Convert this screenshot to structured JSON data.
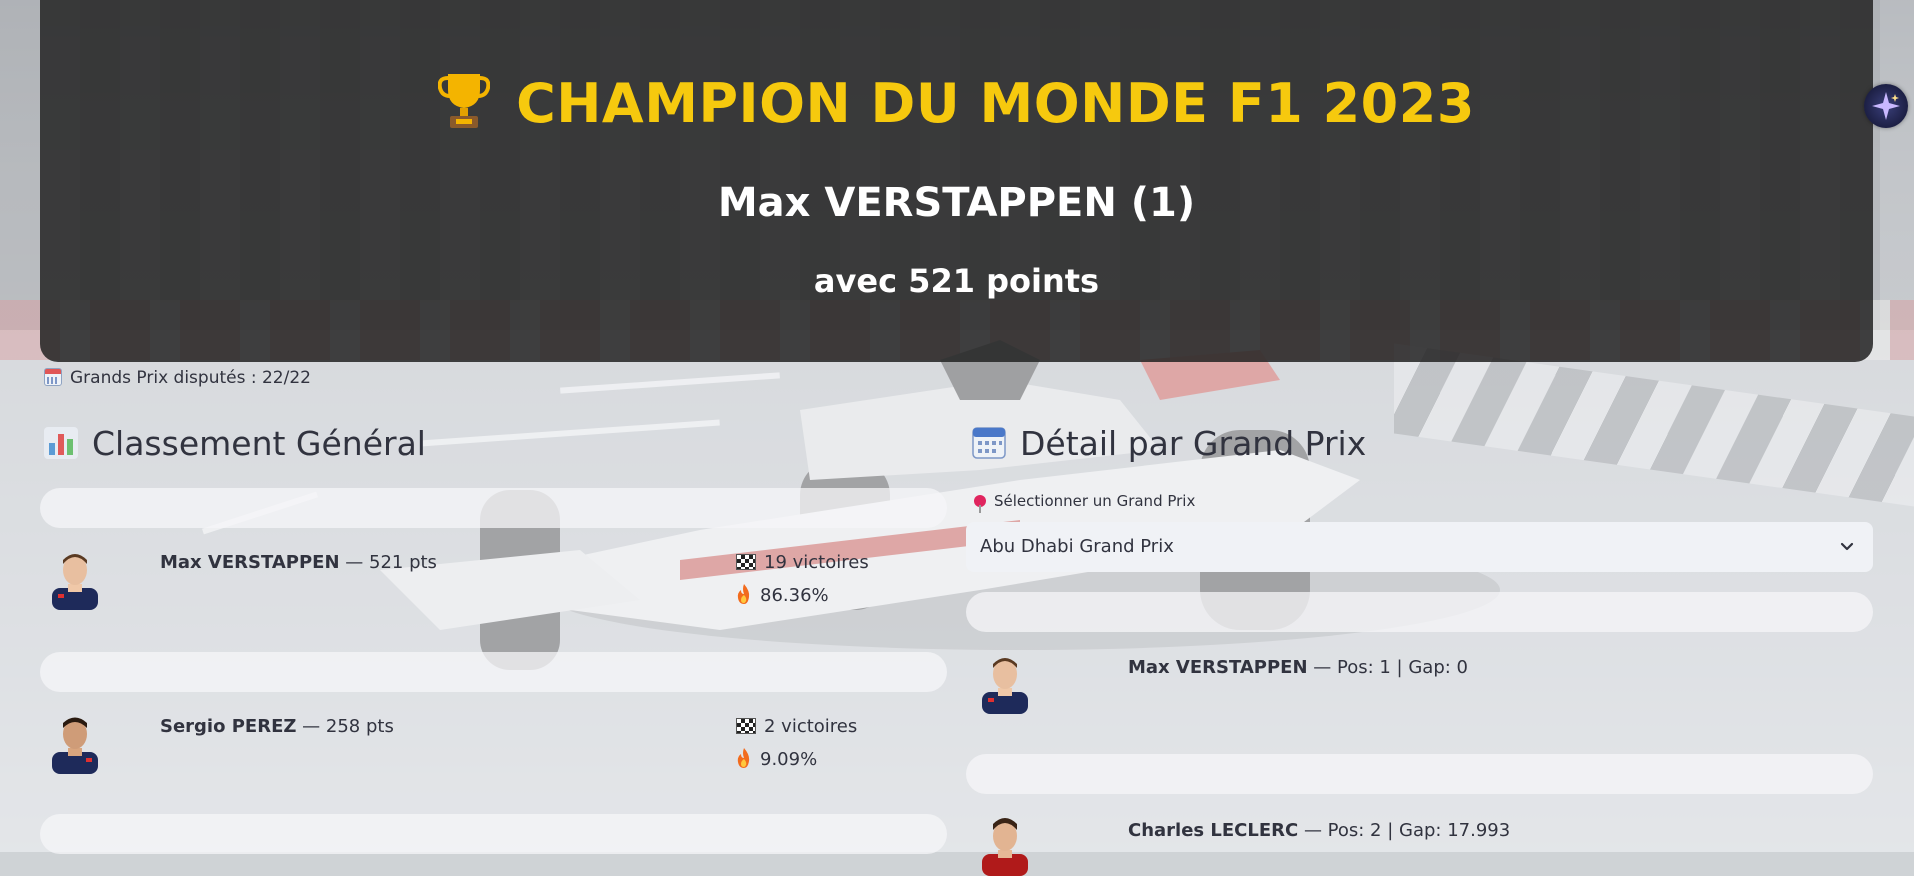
{
  "banner": {
    "title": "CHAMPION DU MONDE F1 2023",
    "champion": "Max VERSTAPPEN (1)",
    "points": "avec 521 points"
  },
  "info": {
    "races_done": "Grands Prix disputés : 22/22"
  },
  "standings": {
    "heading": "Classement Général",
    "drivers": [
      {
        "name": "Max VERSTAPPEN",
        "points": " — 521 pts",
        "wins": "19 victoires",
        "rate": "86.36%"
      },
      {
        "name": "Sergio PEREZ",
        "points": " — 258 pts",
        "wins": "2 victoires",
        "rate": "9.09%"
      }
    ]
  },
  "gp_detail": {
    "heading": "Détail par Grand Prix",
    "select_label": "Sélectionner un Grand Prix",
    "selected_gp": "Abu Dhabi Grand Prix",
    "results": [
      {
        "name": "Max VERSTAPPEN",
        "info": " — Pos: 1 | Gap: 0"
      },
      {
        "name": "Charles LECLERC",
        "info": " — Pos: 2 | Gap: 17.993"
      }
    ]
  },
  "colors": {
    "title_gold": "#f6c90e",
    "banner_bg": "#232323",
    "text": "#31333f"
  },
  "icons": [
    "trophy-icon",
    "calendar-icon",
    "bar-chart-icon",
    "checkered-flag-icon",
    "fire-icon",
    "pushpin-icon",
    "chevron-down-icon",
    "sparkle-icon"
  ]
}
